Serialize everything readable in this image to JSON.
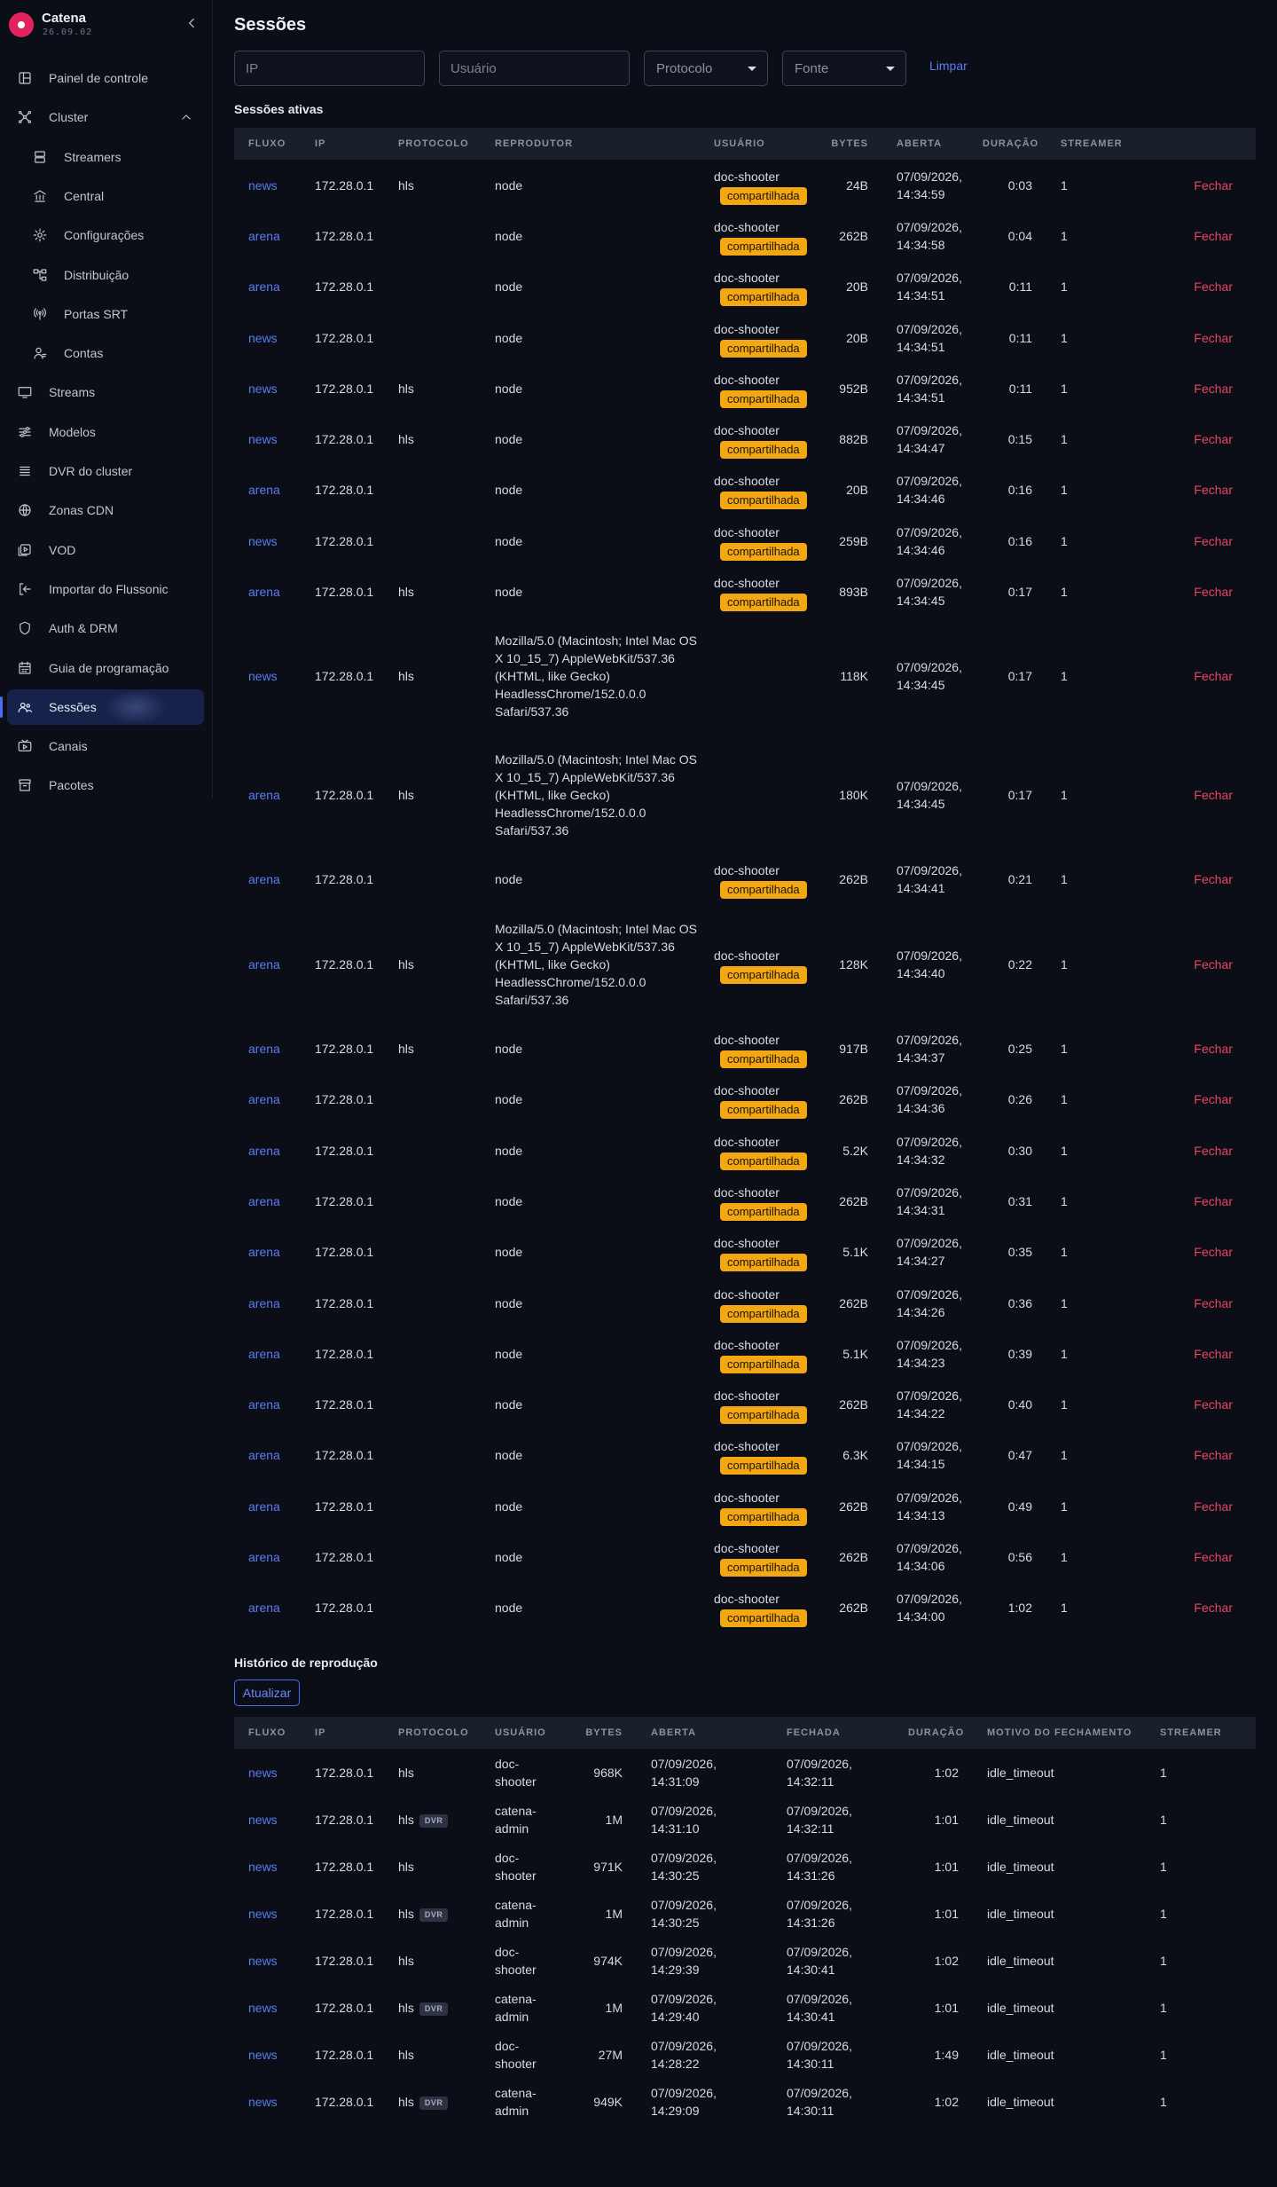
{
  "brand": {
    "name": "Catena",
    "version": "26.09.02"
  },
  "sidebar": {
    "items": [
      {
        "label": "Painel de controle",
        "icon": "dashboard-icon"
      },
      {
        "label": "Cluster",
        "icon": "cluster-icon",
        "expanded": true
      },
      {
        "label": "Streamers",
        "icon": "server-icon",
        "sub": true
      },
      {
        "label": "Central",
        "icon": "bank-icon",
        "sub": true
      },
      {
        "label": "Configurações",
        "icon": "gear-icon",
        "sub": true
      },
      {
        "label": "Distribuição",
        "icon": "distribution-icon",
        "sub": true
      },
      {
        "label": "Portas SRT",
        "icon": "antenna-icon",
        "sub": true
      },
      {
        "label": "Contas",
        "icon": "accounts-icon",
        "sub": true
      },
      {
        "label": "Streams",
        "icon": "monitor-icon"
      },
      {
        "label": "Modelos",
        "icon": "sliders-icon"
      },
      {
        "label": "DVR do cluster",
        "icon": "list-icon"
      },
      {
        "label": "Zonas CDN",
        "icon": "globe-icon"
      },
      {
        "label": "VOD",
        "icon": "vod-icon"
      },
      {
        "label": "Importar do Flussonic",
        "icon": "import-icon"
      },
      {
        "label": "Auth & DRM",
        "icon": "shield-icon"
      },
      {
        "label": "Guia de programação",
        "icon": "calendar-icon"
      },
      {
        "label": "Sessões",
        "icon": "users-icon",
        "active": true
      },
      {
        "label": "Canais",
        "icon": "channel-icon"
      },
      {
        "label": "Pacotes",
        "icon": "package-icon"
      }
    ]
  },
  "page": {
    "title": "Sessões"
  },
  "filters": {
    "ip_placeholder": "IP",
    "user_placeholder": "Usuário",
    "protocol_label": "Protocolo",
    "source_label": "Fonte",
    "clear_label": "Limpar"
  },
  "active": {
    "title": "Sessões ativas",
    "headers": [
      "FLUXO",
      "IP",
      "PROTOCOLO",
      "REPRODUTOR",
      "USUÁRIO",
      "BYTES",
      "ABERTA",
      "DURAÇÃO",
      "STREAMER"
    ],
    "close_label": "Fechar",
    "shared_label": "compartilhada",
    "ua": "Mozilla/5.0 (Macintosh; Intel Mac OS X 10_15_7) AppleWebKit/537.36 (KHTML, like Gecko) HeadlessChrome/152.0.0.0 Safari/537.36",
    "rows": [
      {
        "stream": "news",
        "ip": "172.28.0.1",
        "protocol": "hls",
        "player": "node",
        "user": "doc-shooter",
        "shared": true,
        "bytes": "24B",
        "opened": "07/09/2026, 14:34:59",
        "duration": "0:03",
        "streamer": "1"
      },
      {
        "stream": "arena",
        "ip": "172.28.0.1",
        "protocol": "",
        "player": "node",
        "user": "doc-shooter",
        "shared": true,
        "bytes": "262B",
        "opened": "07/09/2026, 14:34:58",
        "duration": "0:04",
        "streamer": "1"
      },
      {
        "stream": "arena",
        "ip": "172.28.0.1",
        "protocol": "",
        "player": "node",
        "user": "doc-shooter",
        "shared": true,
        "bytes": "20B",
        "opened": "07/09/2026, 14:34:51",
        "duration": "0:11",
        "streamer": "1"
      },
      {
        "stream": "news",
        "ip": "172.28.0.1",
        "protocol": "",
        "player": "node",
        "user": "doc-shooter",
        "shared": true,
        "bytes": "20B",
        "opened": "07/09/2026, 14:34:51",
        "duration": "0:11",
        "streamer": "1"
      },
      {
        "stream": "news",
        "ip": "172.28.0.1",
        "protocol": "hls",
        "player": "node",
        "user": "doc-shooter",
        "shared": true,
        "bytes": "952B",
        "opened": "07/09/2026, 14:34:51",
        "duration": "0:11",
        "streamer": "1"
      },
      {
        "stream": "news",
        "ip": "172.28.0.1",
        "protocol": "hls",
        "player": "node",
        "user": "doc-shooter",
        "shared": true,
        "bytes": "882B",
        "opened": "07/09/2026, 14:34:47",
        "duration": "0:15",
        "streamer": "1"
      },
      {
        "stream": "arena",
        "ip": "172.28.0.1",
        "protocol": "",
        "player": "node",
        "user": "doc-shooter",
        "shared": true,
        "bytes": "20B",
        "opened": "07/09/2026, 14:34:46",
        "duration": "0:16",
        "streamer": "1"
      },
      {
        "stream": "news",
        "ip": "172.28.0.1",
        "protocol": "",
        "player": "node",
        "user": "doc-shooter",
        "shared": true,
        "bytes": "259B",
        "opened": "07/09/2026, 14:34:46",
        "duration": "0:16",
        "streamer": "1"
      },
      {
        "stream": "arena",
        "ip": "172.28.0.1",
        "protocol": "hls",
        "player": "node",
        "user": "doc-shooter",
        "shared": true,
        "bytes": "893B",
        "opened": "07/09/2026, 14:34:45",
        "duration": "0:17",
        "streamer": "1"
      },
      {
        "stream": "news",
        "ip": "172.28.0.1",
        "protocol": "hls",
        "player": "ua",
        "user": "",
        "shared": false,
        "bytes": "118K",
        "opened": "07/09/2026, 14:34:45",
        "duration": "0:17",
        "streamer": "1"
      },
      {
        "stream": "arena",
        "ip": "172.28.0.1",
        "protocol": "hls",
        "player": "ua",
        "user": "",
        "shared": false,
        "bytes": "180K",
        "opened": "07/09/2026, 14:34:45",
        "duration": "0:17",
        "streamer": "1"
      },
      {
        "stream": "arena",
        "ip": "172.28.0.1",
        "protocol": "",
        "player": "node",
        "user": "doc-shooter",
        "shared": true,
        "bytes": "262B",
        "opened": "07/09/2026, 14:34:41",
        "duration": "0:21",
        "streamer": "1"
      },
      {
        "stream": "arena",
        "ip": "172.28.0.1",
        "protocol": "hls",
        "player": "ua",
        "user": "doc-shooter",
        "shared": true,
        "bytes": "128K",
        "opened": "07/09/2026, 14:34:40",
        "duration": "0:22",
        "streamer": "1"
      },
      {
        "stream": "arena",
        "ip": "172.28.0.1",
        "protocol": "hls",
        "player": "node",
        "user": "doc-shooter",
        "shared": true,
        "bytes": "917B",
        "opened": "07/09/2026, 14:34:37",
        "duration": "0:25",
        "streamer": "1"
      },
      {
        "stream": "arena",
        "ip": "172.28.0.1",
        "protocol": "",
        "player": "node",
        "user": "doc-shooter",
        "shared": true,
        "bytes": "262B",
        "opened": "07/09/2026, 14:34:36",
        "duration": "0:26",
        "streamer": "1"
      },
      {
        "stream": "arena",
        "ip": "172.28.0.1",
        "protocol": "",
        "player": "node",
        "user": "doc-shooter",
        "shared": true,
        "bytes": "5.2K",
        "opened": "07/09/2026, 14:34:32",
        "duration": "0:30",
        "streamer": "1"
      },
      {
        "stream": "arena",
        "ip": "172.28.0.1",
        "protocol": "",
        "player": "node",
        "user": "doc-shooter",
        "shared": true,
        "bytes": "262B",
        "opened": "07/09/2026, 14:34:31",
        "duration": "0:31",
        "streamer": "1"
      },
      {
        "stream": "arena",
        "ip": "172.28.0.1",
        "protocol": "",
        "player": "node",
        "user": "doc-shooter",
        "shared": true,
        "bytes": "5.1K",
        "opened": "07/09/2026, 14:34:27",
        "duration": "0:35",
        "streamer": "1"
      },
      {
        "stream": "arena",
        "ip": "172.28.0.1",
        "protocol": "",
        "player": "node",
        "user": "doc-shooter",
        "shared": true,
        "bytes": "262B",
        "opened": "07/09/2026, 14:34:26",
        "duration": "0:36",
        "streamer": "1"
      },
      {
        "stream": "arena",
        "ip": "172.28.0.1",
        "protocol": "",
        "player": "node",
        "user": "doc-shooter",
        "shared": true,
        "bytes": "5.1K",
        "opened": "07/09/2026, 14:34:23",
        "duration": "0:39",
        "streamer": "1"
      },
      {
        "stream": "arena",
        "ip": "172.28.0.1",
        "protocol": "",
        "player": "node",
        "user": "doc-shooter",
        "shared": true,
        "bytes": "262B",
        "opened": "07/09/2026, 14:34:22",
        "duration": "0:40",
        "streamer": "1"
      },
      {
        "stream": "arena",
        "ip": "172.28.0.1",
        "protocol": "",
        "player": "node",
        "user": "doc-shooter",
        "shared": true,
        "bytes": "6.3K",
        "opened": "07/09/2026, 14:34:15",
        "duration": "0:47",
        "streamer": "1"
      },
      {
        "stream": "arena",
        "ip": "172.28.0.1",
        "protocol": "",
        "player": "node",
        "user": "doc-shooter",
        "shared": true,
        "bytes": "262B",
        "opened": "07/09/2026, 14:34:13",
        "duration": "0:49",
        "streamer": "1"
      },
      {
        "stream": "arena",
        "ip": "172.28.0.1",
        "protocol": "",
        "player": "node",
        "user": "doc-shooter",
        "shared": true,
        "bytes": "262B",
        "opened": "07/09/2026, 14:34:06",
        "duration": "0:56",
        "streamer": "1"
      },
      {
        "stream": "arena",
        "ip": "172.28.0.1",
        "protocol": "",
        "player": "node",
        "user": "doc-shooter",
        "shared": true,
        "bytes": "262B",
        "opened": "07/09/2026, 14:34:00",
        "duration": "1:02",
        "streamer": "1"
      }
    ]
  },
  "history": {
    "title": "Histórico de reprodução",
    "refresh_label": "Atualizar",
    "headers": [
      "FLUXO",
      "IP",
      "PROTOCOLO",
      "USUÁRIO",
      "BYTES",
      "ABERTA",
      "FECHADA",
      "DURAÇÃO",
      "MOTIVO DO FECHAMENTO",
      "STREAMER"
    ],
    "dvr_label": "DVR",
    "rows": [
      {
        "stream": "news",
        "ip": "172.28.0.1",
        "protocol": "hls",
        "dvr": false,
        "user": "doc-shooter",
        "bytes": "968K",
        "opened": "07/09/2026, 14:31:09",
        "closed": "07/09/2026, 14:32:11",
        "duration": "1:02",
        "reason": "idle_timeout",
        "streamer": "1"
      },
      {
        "stream": "news",
        "ip": "172.28.0.1",
        "protocol": "hls",
        "dvr": true,
        "user": "catena-admin",
        "bytes": "1M",
        "opened": "07/09/2026, 14:31:10",
        "closed": "07/09/2026, 14:32:11",
        "duration": "1:01",
        "reason": "idle_timeout",
        "streamer": "1"
      },
      {
        "stream": "news",
        "ip": "172.28.0.1",
        "protocol": "hls",
        "dvr": false,
        "user": "doc-shooter",
        "bytes": "971K",
        "opened": "07/09/2026, 14:30:25",
        "closed": "07/09/2026, 14:31:26",
        "duration": "1:01",
        "reason": "idle_timeout",
        "streamer": "1"
      },
      {
        "stream": "news",
        "ip": "172.28.0.1",
        "protocol": "hls",
        "dvr": true,
        "user": "catena-admin",
        "bytes": "1M",
        "opened": "07/09/2026, 14:30:25",
        "closed": "07/09/2026, 14:31:26",
        "duration": "1:01",
        "reason": "idle_timeout",
        "streamer": "1"
      },
      {
        "stream": "news",
        "ip": "172.28.0.1",
        "protocol": "hls",
        "dvr": false,
        "user": "doc-shooter",
        "bytes": "974K",
        "opened": "07/09/2026, 14:29:39",
        "closed": "07/09/2026, 14:30:41",
        "duration": "1:02",
        "reason": "idle_timeout",
        "streamer": "1"
      },
      {
        "stream": "news",
        "ip": "172.28.0.1",
        "protocol": "hls",
        "dvr": true,
        "user": "catena-admin",
        "bytes": "1M",
        "opened": "07/09/2026, 14:29:40",
        "closed": "07/09/2026, 14:30:41",
        "duration": "1:01",
        "reason": "idle_timeout",
        "streamer": "1"
      },
      {
        "stream": "news",
        "ip": "172.28.0.1",
        "protocol": "hls",
        "dvr": false,
        "user": "doc-shooter",
        "bytes": "27M",
        "opened": "07/09/2026, 14:28:22",
        "closed": "07/09/2026, 14:30:11",
        "duration": "1:49",
        "reason": "idle_timeout",
        "streamer": "1"
      },
      {
        "stream": "news",
        "ip": "172.28.0.1",
        "protocol": "hls",
        "dvr": true,
        "user": "catena-admin",
        "bytes": "949K",
        "opened": "07/09/2026, 14:29:09",
        "closed": "07/09/2026, 14:30:11",
        "duration": "1:02",
        "reason": "idle_timeout",
        "streamer": "1"
      }
    ]
  }
}
